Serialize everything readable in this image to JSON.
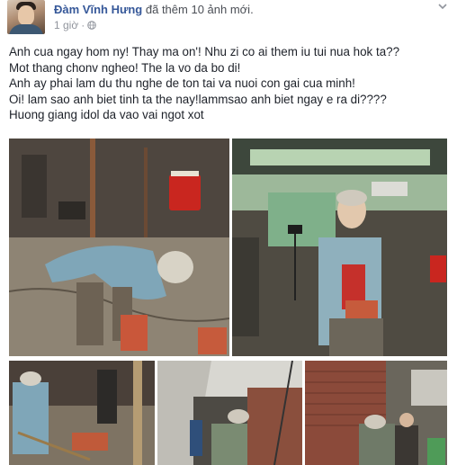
{
  "post": {
    "author": "Đàm Vĩnh Hưng",
    "action": "đã thêm 10 ảnh mới.",
    "time": "1 giờ",
    "separator": "·",
    "text_lines": [
      "Anh cua ngay hom ny! Thay ma on'! Nhu zi co ai them iu tui nua hok ta??",
      "Mot thang chonv ngheo! The la vo da bo di!",
      "Anh ay phai lam du thu nghe de ton tai va nuoi con gai cua minh!",
      "Oi! lam sao anh biet tinh ta the nay!lammsao anh biet ngay e ra di????",
      "Huong giang idol da vao vai ngot xot"
    ]
  },
  "icons": {
    "privacy": "globe-icon",
    "options": "chevron-down-icon"
  },
  "colors": {
    "author_link": "#365899",
    "meta_text": "#90949c",
    "body_text": "#1d2129"
  }
}
